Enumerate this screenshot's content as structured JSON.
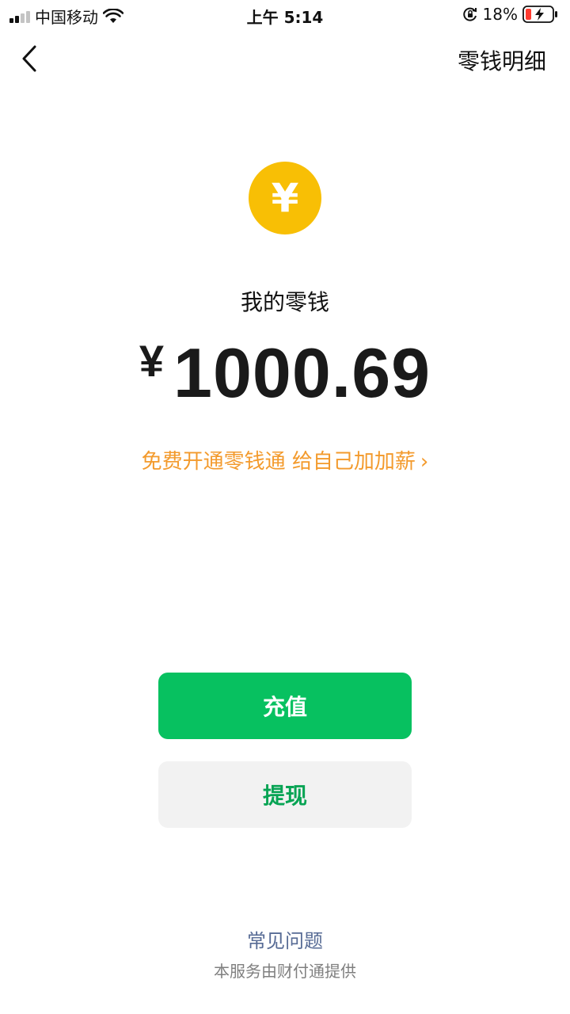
{
  "status_bar": {
    "carrier": "中国移动",
    "time": "上午 5:14",
    "battery": "18%"
  },
  "nav": {
    "title": "零钱明细",
    "back_icon": "chevron-left-icon"
  },
  "wallet": {
    "coin_icon": "yuan-coin-icon",
    "coin_glyph": "¥",
    "label": "我的零钱",
    "currency": "¥",
    "amount": "1000.69",
    "promo": "免费开通零钱通 给自己加加薪",
    "promo_chevron": "›"
  },
  "actions": {
    "recharge": "充值",
    "withdraw": "提现"
  },
  "footer": {
    "faq": "常见问题",
    "provider": "本服务由财付通提供"
  },
  "colors": {
    "accent_green": "#07c160",
    "coin_yellow": "#f8bf05",
    "promo_orange": "#f39a2c",
    "link_blue": "#576b95"
  }
}
